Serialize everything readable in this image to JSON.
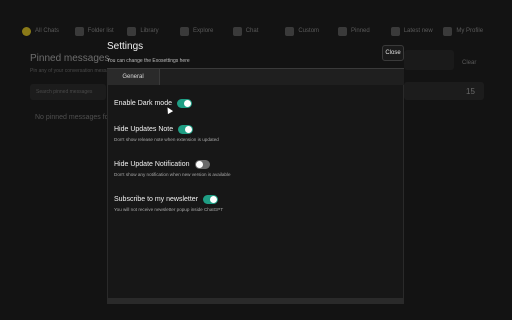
{
  "background": {
    "nav": [
      {
        "label": "All Chats",
        "icon": "chat-bubble-icon"
      },
      {
        "label": "Folder list",
        "icon": "folder-icon"
      },
      {
        "label": "Library",
        "icon": "library-icon"
      },
      {
        "label": "Explore",
        "icon": "compass-icon"
      },
      {
        "label": "Chat",
        "icon": "chat-icon"
      },
      {
        "label": "Custom",
        "icon": "custom-icon"
      },
      {
        "label": "Pinned",
        "icon": "pin-icon"
      },
      {
        "label": "Latest new",
        "icon": "news-icon"
      },
      {
        "label": "My Profile",
        "icon": "profile-icon"
      }
    ],
    "title": "Pinned messages",
    "subtitle": "Pin any of your conversation messages",
    "search_placeholder": "Search pinned messages",
    "empty_text": "No pinned messages found",
    "right_button": "Clear",
    "right_count": "15"
  },
  "modal": {
    "title": "Settings",
    "subtitle": "You can change the Exosettings here",
    "close_label": "Close",
    "tabs": [
      {
        "label": "General",
        "active": true
      }
    ],
    "settings": [
      {
        "label": "Enable Dark mode",
        "description": "",
        "enabled": true
      },
      {
        "label": "Hide Updates Note",
        "description": "Don't show release note when extension is updated",
        "enabled": true
      },
      {
        "label": "Hide Update Notification",
        "description": "Don't show any notification when new version is available",
        "enabled": false
      },
      {
        "label": "Subscribe to my newsletter",
        "description": "You will not receive newsletter popup inside ChatGPT",
        "enabled": true
      }
    ]
  },
  "colors": {
    "toggle_on": "#1f9e84",
    "toggle_off": "#6a6a6a",
    "backdrop": "#0b0b0b"
  }
}
